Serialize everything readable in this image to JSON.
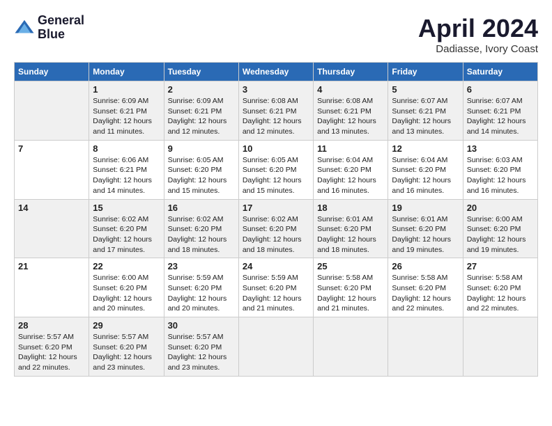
{
  "logo": {
    "line1": "General",
    "line2": "Blue"
  },
  "header": {
    "month": "April 2024",
    "location": "Dadiasse, Ivory Coast"
  },
  "days_of_week": [
    "Sunday",
    "Monday",
    "Tuesday",
    "Wednesday",
    "Thursday",
    "Friday",
    "Saturday"
  ],
  "weeks": [
    [
      {
        "day": "",
        "info": ""
      },
      {
        "day": "1",
        "info": "Sunrise: 6:09 AM\nSunset: 6:21 PM\nDaylight: 12 hours\nand 11 minutes."
      },
      {
        "day": "2",
        "info": "Sunrise: 6:09 AM\nSunset: 6:21 PM\nDaylight: 12 hours\nand 12 minutes."
      },
      {
        "day": "3",
        "info": "Sunrise: 6:08 AM\nSunset: 6:21 PM\nDaylight: 12 hours\nand 12 minutes."
      },
      {
        "day": "4",
        "info": "Sunrise: 6:08 AM\nSunset: 6:21 PM\nDaylight: 12 hours\nand 13 minutes."
      },
      {
        "day": "5",
        "info": "Sunrise: 6:07 AM\nSunset: 6:21 PM\nDaylight: 12 hours\nand 13 minutes."
      },
      {
        "day": "6",
        "info": "Sunrise: 6:07 AM\nSunset: 6:21 PM\nDaylight: 12 hours\nand 14 minutes."
      }
    ],
    [
      {
        "day": "7",
        "info": ""
      },
      {
        "day": "8",
        "info": "Sunrise: 6:06 AM\nSunset: 6:21 PM\nDaylight: 12 hours\nand 14 minutes."
      },
      {
        "day": "9",
        "info": "Sunrise: 6:05 AM\nSunset: 6:20 PM\nDaylight: 12 hours\nand 15 minutes."
      },
      {
        "day": "10",
        "info": "Sunrise: 6:05 AM\nSunset: 6:20 PM\nDaylight: 12 hours\nand 15 minutes."
      },
      {
        "day": "11",
        "info": "Sunrise: 6:04 AM\nSunset: 6:20 PM\nDaylight: 12 hours\nand 16 minutes."
      },
      {
        "day": "12",
        "info": "Sunrise: 6:04 AM\nSunset: 6:20 PM\nDaylight: 12 hours\nand 16 minutes."
      },
      {
        "day": "13",
        "info": "Sunrise: 6:03 AM\nSunset: 6:20 PM\nDaylight: 12 hours\nand 16 minutes."
      }
    ],
    [
      {
        "day": "14",
        "info": ""
      },
      {
        "day": "15",
        "info": "Sunrise: 6:02 AM\nSunset: 6:20 PM\nDaylight: 12 hours\nand 17 minutes."
      },
      {
        "day": "16",
        "info": "Sunrise: 6:02 AM\nSunset: 6:20 PM\nDaylight: 12 hours\nand 18 minutes."
      },
      {
        "day": "17",
        "info": "Sunrise: 6:02 AM\nSunset: 6:20 PM\nDaylight: 12 hours\nand 18 minutes."
      },
      {
        "day": "18",
        "info": "Sunrise: 6:01 AM\nSunset: 6:20 PM\nDaylight: 12 hours\nand 18 minutes."
      },
      {
        "day": "19",
        "info": "Sunrise: 6:01 AM\nSunset: 6:20 PM\nDaylight: 12 hours\nand 19 minutes."
      },
      {
        "day": "20",
        "info": "Sunrise: 6:00 AM\nSunset: 6:20 PM\nDaylight: 12 hours\nand 19 minutes."
      }
    ],
    [
      {
        "day": "21",
        "info": ""
      },
      {
        "day": "22",
        "info": "Sunrise: 6:00 AM\nSunset: 6:20 PM\nDaylight: 12 hours\nand 20 minutes."
      },
      {
        "day": "23",
        "info": "Sunrise: 5:59 AM\nSunset: 6:20 PM\nDaylight: 12 hours\nand 20 minutes."
      },
      {
        "day": "24",
        "info": "Sunrise: 5:59 AM\nSunset: 6:20 PM\nDaylight: 12 hours\nand 21 minutes."
      },
      {
        "day": "25",
        "info": "Sunrise: 5:58 AM\nSunset: 6:20 PM\nDaylight: 12 hours\nand 21 minutes."
      },
      {
        "day": "26",
        "info": "Sunrise: 5:58 AM\nSunset: 6:20 PM\nDaylight: 12 hours\nand 22 minutes."
      },
      {
        "day": "27",
        "info": "Sunrise: 5:58 AM\nSunset: 6:20 PM\nDaylight: 12 hours\nand 22 minutes."
      }
    ],
    [
      {
        "day": "28",
        "info": "Sunrise: 5:57 AM\nSunset: 6:20 PM\nDaylight: 12 hours\nand 22 minutes."
      },
      {
        "day": "29",
        "info": "Sunrise: 5:57 AM\nSunset: 6:20 PM\nDaylight: 12 hours\nand 23 minutes."
      },
      {
        "day": "30",
        "info": "Sunrise: 5:57 AM\nSunset: 6:20 PM\nDaylight: 12 hours\nand 23 minutes."
      },
      {
        "day": "",
        "info": ""
      },
      {
        "day": "",
        "info": ""
      },
      {
        "day": "",
        "info": ""
      },
      {
        "day": "",
        "info": ""
      }
    ]
  ],
  "week_row_shading": [
    true,
    false,
    true,
    false,
    true
  ]
}
